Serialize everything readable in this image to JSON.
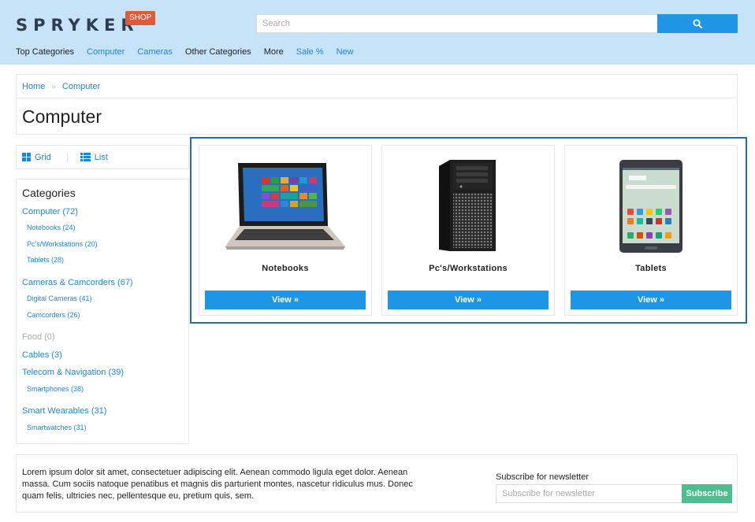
{
  "header": {
    "logo_text": "SPRYKER",
    "logo_badge": "SHOP",
    "search_placeholder": "Search",
    "nav": [
      {
        "label": "Top Categories",
        "style": "dark"
      },
      {
        "label": "Computer",
        "style": "blue"
      },
      {
        "label": "Cameras",
        "style": "blue"
      },
      {
        "label": "Other Categories",
        "style": "dark"
      },
      {
        "label": "More",
        "style": "dark"
      },
      {
        "label": "Sale %",
        "style": "blue"
      },
      {
        "label": "New",
        "style": "blue"
      }
    ]
  },
  "breadcrumb": {
    "items": [
      "Home",
      "Computer"
    ],
    "separator": "»"
  },
  "page_title": "Computer",
  "view_toggle": {
    "grid_label": "Grid",
    "list_label": "List"
  },
  "sidebar": {
    "heading": "Categories",
    "items": [
      {
        "label": "Computer (72)",
        "level": 1
      },
      {
        "label": "Notebooks (24)",
        "level": 2
      },
      {
        "label": "Pc's/Workstations (20)",
        "level": 2
      },
      {
        "label": "Tablets (28)",
        "level": 2
      },
      {
        "label": "Cameras & Camcorders (67)",
        "level": 1
      },
      {
        "label": "Digital Cameras (41)",
        "level": 2
      },
      {
        "label": "Camcorders (26)",
        "level": 2
      },
      {
        "label": "Food (0)",
        "level": 1,
        "muted": true
      },
      {
        "label": "Cables (3)",
        "level": 1
      },
      {
        "label": "Telecom & Navigation (39)",
        "level": 1
      },
      {
        "label": "Smartphones (38)",
        "level": 2
      },
      {
        "label": "Smart Wearables (31)",
        "level": 1
      },
      {
        "label": "Smartwatches (31)",
        "level": 2
      }
    ]
  },
  "products": [
    {
      "name": "Notebooks",
      "button": "View »",
      "icon": "laptop-image"
    },
    {
      "name": "Pc's/Workstations",
      "button": "View »",
      "icon": "pc-tower-image"
    },
    {
      "name": "Tablets",
      "button": "View »",
      "icon": "tablet-image"
    }
  ],
  "footer": {
    "lorem": "Lorem ipsum dolor sit amet, consectetuer adipiscing elit. Aenean commodo ligula eget dolor. Aenean massa. Cum sociis natoque penatibus et magnis dis parturient montes, nascetur ridiculus mus. Donec quam felis, ultricies nec, pellentesque eu, pretium quis, sem.",
    "newsletter_label": "Subscribe for newsletter",
    "newsletter_placeholder": "Subscribe for newsletter",
    "subscribe_button": "Subscribe"
  },
  "colors": {
    "header_bg": "#c6e3f7",
    "accent_blue": "#1f96e5",
    "link_blue": "#1d86d9",
    "badge_red": "#e05a3a",
    "subscribe_green": "#4cbf8f",
    "highlight_border": "#1d6fae"
  }
}
